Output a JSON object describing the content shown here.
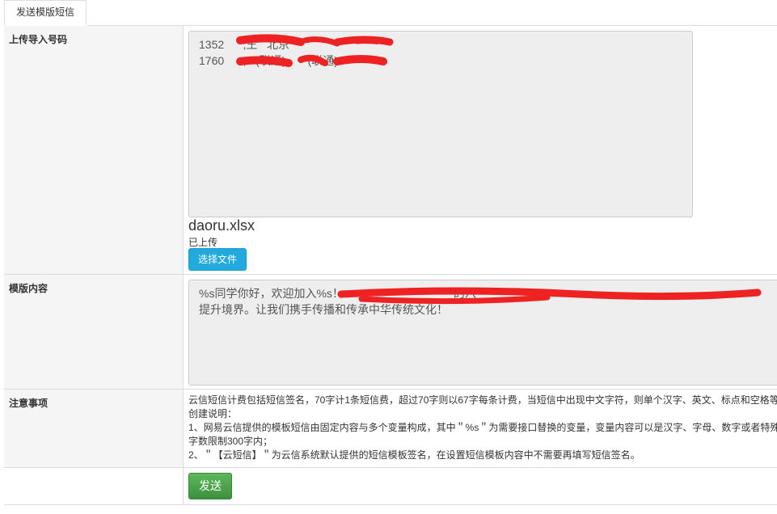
{
  "tab": {
    "label": "发送模版短信"
  },
  "rows": {
    "upload": {
      "label": "上传导入号码",
      "textarea": "1352      ,王   北京\n1760      ,   (联通),      (联通)",
      "filename": "daoru.xlsx",
      "status": "已上传",
      "choose_button": "选择文件"
    },
    "template": {
      "label": "模版内容",
      "textarea": "%s同学你好，欢迎加入%s！                                   的八                        \n提升境界。让我们携手传播和传承中华传统文化！"
    },
    "notes": {
      "label": "注意事项",
      "lines": [
        "云信短信计费包括短信签名，70字计1条短信费，超过70字则以67字每条计费，当短信中出现中文字符，则单个汉字、英文、标点和空格等",
        "创建说明：",
        "1、网易云信提供的模板短信由固定内容与多个变量构成，其中＂%s＂为需要接口替换的变量，变量内容可以是汉字、字母、数字或者特殊",
        "字数限制300字内；",
        "2、＂【云短信】＂为云信系统默认提供的短信模板签名，在设置短信模板内容中不需要再填写短信签名。"
      ]
    },
    "send": {
      "button": "发送"
    }
  },
  "colors": {
    "redaction": "#ee2222",
    "choose_button": "#22aadd",
    "send_button": "#4cae4c"
  }
}
